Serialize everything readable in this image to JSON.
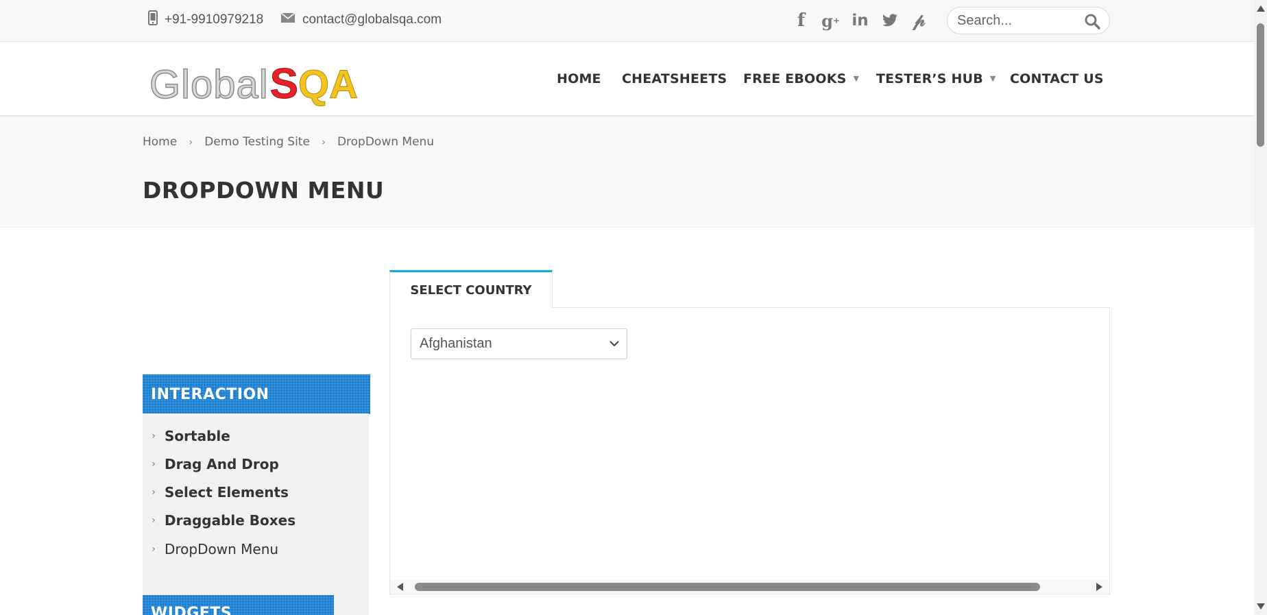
{
  "topbar": {
    "phone": "+91-9910979218",
    "email": "contact@globalsqa.com",
    "social": [
      "facebook-icon",
      "google-plus-icon",
      "linkedin-icon",
      "twitter-icon",
      "pinterest-icon"
    ],
    "search_placeholder": "Search..."
  },
  "header": {
    "logo_part1": "Global",
    "logo_part2": "S",
    "logo_part3": "QA",
    "nav": {
      "home": "HOME",
      "cheatsheets": "CHEATSHEETS",
      "free_ebooks": "FREE EBOOKS",
      "testers_hub": "TESTER’S HUB",
      "contact_us": "CONTACT US"
    }
  },
  "breadcrumb": {
    "home": "Home",
    "demo": "Demo Testing Site",
    "current": "DropDown Menu"
  },
  "page_title": "DROPDOWN MENU",
  "sidebar": {
    "interaction_title": "INTERACTION",
    "items": [
      "Sortable",
      "Drag And Drop",
      "Select Elements",
      "Draggable Boxes",
      "DropDown Menu"
    ],
    "widgets_title": "WIDGETS"
  },
  "content": {
    "tab_label": "SELECT COUNTRY",
    "select_value": "Afghanistan"
  },
  "colors": {
    "accent": "#17a9e1",
    "sidebar_head": "#1b7fd1",
    "logo_red": "#e8202a",
    "logo_yellow": "#f4c320"
  }
}
